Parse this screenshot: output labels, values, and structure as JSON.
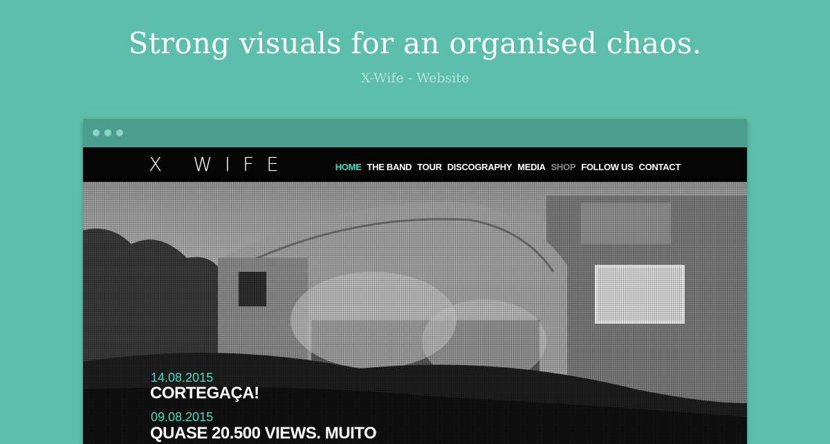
{
  "header": {
    "headline": "Strong visuals for an organised chaos.",
    "subline": "X-Wife - Website"
  },
  "site": {
    "logo": "X WIFE",
    "nav": [
      {
        "label": "HOME",
        "state": "active"
      },
      {
        "label": "THE BAND",
        "state": "normal"
      },
      {
        "label": "TOUR",
        "state": "normal"
      },
      {
        "label": "DISCOGRAPHY",
        "state": "normal"
      },
      {
        "label": "MEDIA",
        "state": "normal"
      },
      {
        "label": "SHOP",
        "state": "muted"
      },
      {
        "label": "FOLLOW US",
        "state": "normal"
      },
      {
        "label": "CONTACT",
        "state": "normal"
      }
    ],
    "posts": [
      {
        "date": "14.08.2015",
        "title": "CORTEGAÇA!"
      },
      {
        "date": "09.08.2015",
        "title": "QUASE 20.500 VIEWS. MUITO"
      }
    ]
  },
  "colors": {
    "background": "#5cbfac",
    "accent": "#3ee0c0",
    "chrome": "#4b9e8d"
  }
}
